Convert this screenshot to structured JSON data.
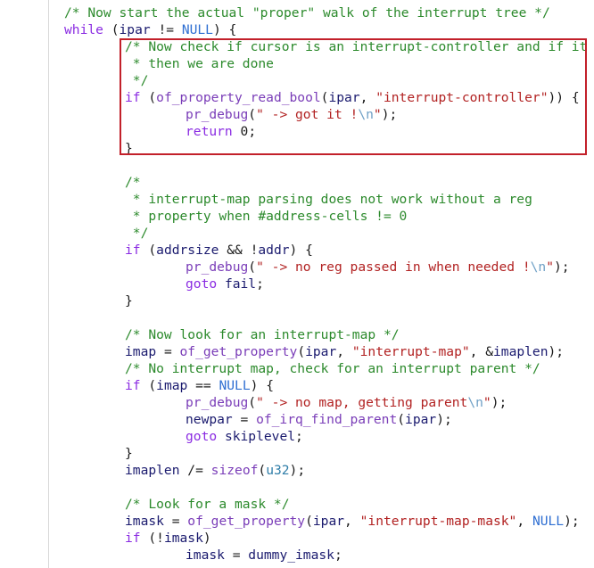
{
  "editor": {
    "lines": [
      [
        {
          "t": "comment",
          "v": "/* Now start the actual \"proper\" walk of the interrupt tree */"
        }
      ],
      [
        {
          "t": "keyword",
          "v": "while"
        },
        {
          "t": "punct",
          "v": " ("
        },
        {
          "t": "ident",
          "v": "ipar"
        },
        {
          "t": "punct",
          "v": " != "
        },
        {
          "t": "macro",
          "v": "NULL"
        },
        {
          "t": "punct",
          "v": ") {"
        }
      ],
      [
        {
          "t": "comment",
          "v": "/* Now check if cursor is an interrupt-controller and if it is"
        }
      ],
      [
        {
          "t": "comment",
          "v": " * then we are done"
        }
      ],
      [
        {
          "t": "comment",
          "v": " */"
        }
      ],
      [
        {
          "t": "keyword",
          "v": "if"
        },
        {
          "t": "punct",
          "v": " ("
        },
        {
          "t": "func",
          "v": "of_property_read_bool"
        },
        {
          "t": "punct",
          "v": "("
        },
        {
          "t": "ident",
          "v": "ipar"
        },
        {
          "t": "punct",
          "v": ", "
        },
        {
          "t": "string",
          "v": "\"interrupt-controller\""
        },
        {
          "t": "punct",
          "v": ")) {"
        }
      ],
      [
        {
          "t": "func",
          "v": "pr_debug"
        },
        {
          "t": "punct",
          "v": "("
        },
        {
          "t": "string",
          "v": "\" -> got it !"
        },
        {
          "t": "escape",
          "v": "\\n"
        },
        {
          "t": "string",
          "v": "\""
        },
        {
          "t": "punct",
          "v": ");"
        }
      ],
      [
        {
          "t": "keyword",
          "v": "return"
        },
        {
          "t": "punct",
          "v": " "
        },
        {
          "t": "number",
          "v": "0"
        },
        {
          "t": "punct",
          "v": ";"
        }
      ],
      [
        {
          "t": "punct",
          "v": "}"
        }
      ],
      [],
      [
        {
          "t": "comment",
          "v": "/*"
        }
      ],
      [
        {
          "t": "comment",
          "v": " * interrupt-map parsing does not work without a reg"
        }
      ],
      [
        {
          "t": "comment",
          "v": " * property when #address-cells != 0"
        }
      ],
      [
        {
          "t": "comment",
          "v": " */"
        }
      ],
      [
        {
          "t": "keyword",
          "v": "if"
        },
        {
          "t": "punct",
          "v": " ("
        },
        {
          "t": "ident",
          "v": "addrsize"
        },
        {
          "t": "punct",
          "v": " && !"
        },
        {
          "t": "ident",
          "v": "addr"
        },
        {
          "t": "punct",
          "v": ") {"
        }
      ],
      [
        {
          "t": "func",
          "v": "pr_debug"
        },
        {
          "t": "punct",
          "v": "("
        },
        {
          "t": "string",
          "v": "\" -> no reg passed in when needed !"
        },
        {
          "t": "escape",
          "v": "\\n"
        },
        {
          "t": "string",
          "v": "\""
        },
        {
          "t": "punct",
          "v": ");"
        }
      ],
      [
        {
          "t": "keyword",
          "v": "goto"
        },
        {
          "t": "punct",
          "v": " "
        },
        {
          "t": "ident",
          "v": "fail"
        },
        {
          "t": "punct",
          "v": ";"
        }
      ],
      [
        {
          "t": "punct",
          "v": "}"
        }
      ],
      [],
      [
        {
          "t": "comment",
          "v": "/* Now look for an interrupt-map */"
        }
      ],
      [
        {
          "t": "ident",
          "v": "imap"
        },
        {
          "t": "punct",
          "v": " = "
        },
        {
          "t": "func",
          "v": "of_get_property"
        },
        {
          "t": "punct",
          "v": "("
        },
        {
          "t": "ident",
          "v": "ipar"
        },
        {
          "t": "punct",
          "v": ", "
        },
        {
          "t": "string",
          "v": "\"interrupt-map\""
        },
        {
          "t": "punct",
          "v": ", &"
        },
        {
          "t": "ident",
          "v": "imaplen"
        },
        {
          "t": "punct",
          "v": ");"
        }
      ],
      [
        {
          "t": "comment",
          "v": "/* No interrupt map, check for an interrupt parent */"
        }
      ],
      [
        {
          "t": "keyword",
          "v": "if"
        },
        {
          "t": "punct",
          "v": " ("
        },
        {
          "t": "ident",
          "v": "imap"
        },
        {
          "t": "punct",
          "v": " == "
        },
        {
          "t": "macro",
          "v": "NULL"
        },
        {
          "t": "punct",
          "v": ") {"
        }
      ],
      [
        {
          "t": "func",
          "v": "pr_debug"
        },
        {
          "t": "punct",
          "v": "("
        },
        {
          "t": "string",
          "v": "\" -> no map, getting parent"
        },
        {
          "t": "escape",
          "v": "\\n"
        },
        {
          "t": "string",
          "v": "\""
        },
        {
          "t": "punct",
          "v": ");"
        }
      ],
      [
        {
          "t": "ident",
          "v": "newpar"
        },
        {
          "t": "punct",
          "v": " = "
        },
        {
          "t": "func",
          "v": "of_irq_find_parent"
        },
        {
          "t": "punct",
          "v": "("
        },
        {
          "t": "ident",
          "v": "ipar"
        },
        {
          "t": "punct",
          "v": ");"
        }
      ],
      [
        {
          "t": "keyword",
          "v": "goto"
        },
        {
          "t": "punct",
          "v": " "
        },
        {
          "t": "ident",
          "v": "skiplevel"
        },
        {
          "t": "punct",
          "v": ";"
        }
      ],
      [
        {
          "t": "punct",
          "v": "}"
        }
      ],
      [
        {
          "t": "ident",
          "v": "imaplen"
        },
        {
          "t": "punct",
          "v": " /= "
        },
        {
          "t": "func",
          "v": "sizeof"
        },
        {
          "t": "punct",
          "v": "("
        },
        {
          "t": "type",
          "v": "u32"
        },
        {
          "t": "punct",
          "v": ");"
        }
      ],
      [],
      [
        {
          "t": "comment",
          "v": "/* Look for a mask */"
        }
      ],
      [
        {
          "t": "ident",
          "v": "imask"
        },
        {
          "t": "punct",
          "v": " = "
        },
        {
          "t": "func",
          "v": "of_get_property"
        },
        {
          "t": "punct",
          "v": "("
        },
        {
          "t": "ident",
          "v": "ipar"
        },
        {
          "t": "punct",
          "v": ", "
        },
        {
          "t": "string",
          "v": "\"interrupt-map-mask\""
        },
        {
          "t": "punct",
          "v": ", "
        },
        {
          "t": "macro",
          "v": "NULL"
        },
        {
          "t": "punct",
          "v": ");"
        }
      ],
      [
        {
          "t": "keyword",
          "v": "if"
        },
        {
          "t": "punct",
          "v": " (!"
        },
        {
          "t": "ident",
          "v": "imask"
        },
        {
          "t": "punct",
          "v": ")"
        }
      ],
      [
        {
          "t": "ident",
          "v": "imask"
        },
        {
          "t": "punct",
          "v": " = "
        },
        {
          "t": "ident",
          "v": "dummy_imask"
        },
        {
          "t": "punct",
          "v": ";"
        }
      ]
    ]
  },
  "highlight": {
    "color": "#c2202a",
    "first_line": 3,
    "last_line": 9
  },
  "colors": {
    "comment": "#2c8a2c",
    "keyword": "#8a2be2",
    "string": "#b22222",
    "escape": "#6fa0c6",
    "macro": "#2f6fd2"
  }
}
